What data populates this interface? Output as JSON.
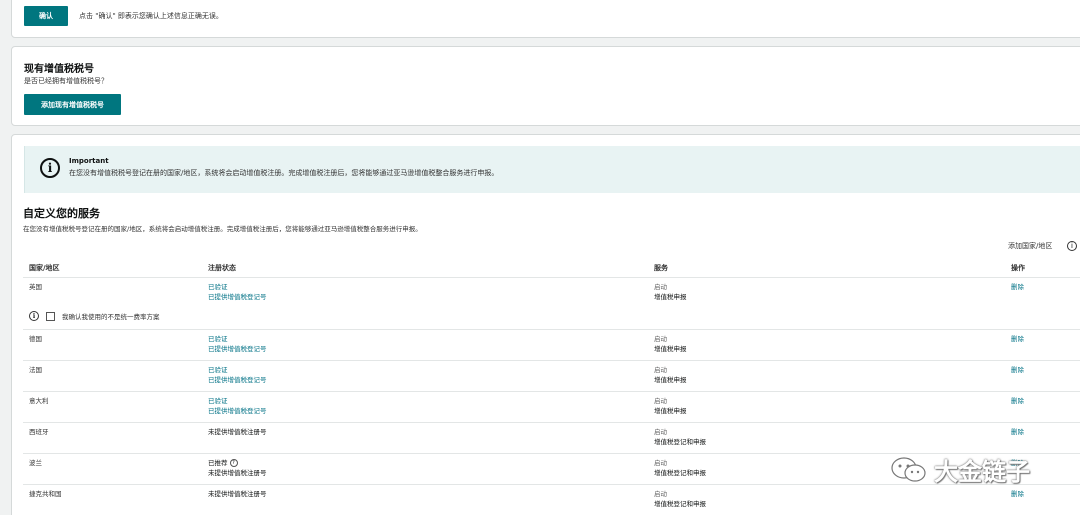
{
  "confirm": {
    "button": "确认",
    "note": "点击 \"确认\" 即表示您确认上述信息正确无误。"
  },
  "vat": {
    "title": "现有增值税税号",
    "question": "是否已经拥有增值税税号？",
    "button": "添加现有增值税税号"
  },
  "alert": {
    "title": "Important",
    "body": "在您没有增值税税号登记在册的国家/地区，系统将会启动增值税注册。完成增值税注册后，您将能够通过亚马逊增值税整合服务进行申报。"
  },
  "services": {
    "title": "自定义您的服务",
    "subtitle": "在您没有增值税税号登记在册的国家/地区，系统将会启动增值税注册。完成增值税注册后，您将能够通过亚马逊增值税整合服务进行申报。",
    "add_country": "添加国家/地区",
    "headers": {
      "country": "国家/地区",
      "status": "注册状态",
      "service": "服务",
      "action": "操作"
    },
    "checkbox_label": "我确认我使用的不是统一费率方案",
    "rows": [
      {
        "country": "英国",
        "status1": "已验证",
        "status2": "已提供增值税登记号",
        "service1": "启动",
        "service2": "增值税申报",
        "action": "删除"
      },
      {
        "country": "德国",
        "status1": "已验证",
        "status2": "已提供增值税登记号",
        "service1": "启动",
        "service2": "增值税申报",
        "action": "删除"
      },
      {
        "country": "法国",
        "status1": "已验证",
        "status2": "已提供增值税登记号",
        "service1": "启动",
        "service2": "增值税申报",
        "action": "删除"
      },
      {
        "country": "意大利",
        "status1": "已验证",
        "status2": "已提供增值税登记号",
        "service1": "启动",
        "service2": "增值税申报",
        "action": "删除"
      },
      {
        "country": "西班牙",
        "status1": "未提供增值税注册号",
        "status2": "",
        "service1": "启动",
        "service2": "增值税登记和申报",
        "action": "删除"
      },
      {
        "country": "波兰",
        "status1": "已推荐",
        "status2": "未提供增值税注册号",
        "service1": "启动",
        "service2": "增值税登记和申报",
        "action": "删除"
      },
      {
        "country": "捷克共和国",
        "status1": "未提供增值税注册号",
        "status2": "",
        "service1": "启动",
        "service2": "增值税登记和申报",
        "action": "删除"
      }
    ]
  },
  "watermark": {
    "text": "大金链子"
  },
  "colors": {
    "teal_button": "#00767f",
    "link": "#007185",
    "alert_bg": "#e8f3f3"
  }
}
